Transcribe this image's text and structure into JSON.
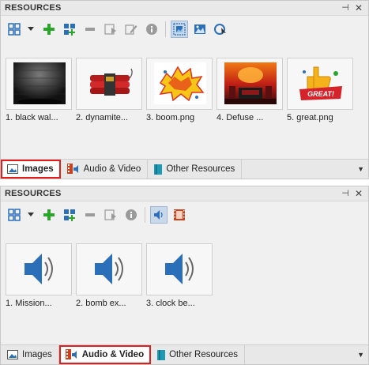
{
  "panel1": {
    "title": "RESOURCES",
    "pin_glyph": "⊣",
    "close_glyph": "✕",
    "items": [
      {
        "caption": "1. black wal...",
        "icon": "black-wall-thumbnail"
      },
      {
        "caption": "2. dynamite...",
        "icon": "dynamite-thumbnail"
      },
      {
        "caption": "3. boom.png",
        "icon": "boom-thumbnail"
      },
      {
        "caption": "4. Defuse ...",
        "icon": "defuse-thumbnail"
      },
      {
        "caption": "5. great.png",
        "icon": "great-thumbnail"
      }
    ],
    "tabs": [
      {
        "label": "Images",
        "selected": true,
        "highlighted": true
      },
      {
        "label": "Audio & Video",
        "selected": false
      },
      {
        "label": "Other Resources",
        "selected": false
      }
    ]
  },
  "panel2": {
    "title": "RESOURCES",
    "pin_glyph": "⊣",
    "close_glyph": "✕",
    "items": [
      {
        "caption": "1. Mission...",
        "icon": "audio-file-icon"
      },
      {
        "caption": "2. bomb ex...",
        "icon": "audio-file-icon"
      },
      {
        "caption": "3. clock be...",
        "icon": "audio-file-icon"
      }
    ],
    "tabs": [
      {
        "label": "Images",
        "selected": false
      },
      {
        "label": "Audio & Video",
        "selected": true,
        "highlighted": true
      },
      {
        "label": "Other Resources",
        "selected": false
      }
    ]
  },
  "scroll_glyph": "▼",
  "colors": {
    "highlight": "#e31c1c",
    "add": "#2aa52a",
    "accent": "#2a6fb8",
    "selected_tool": "#c9d9ea"
  }
}
